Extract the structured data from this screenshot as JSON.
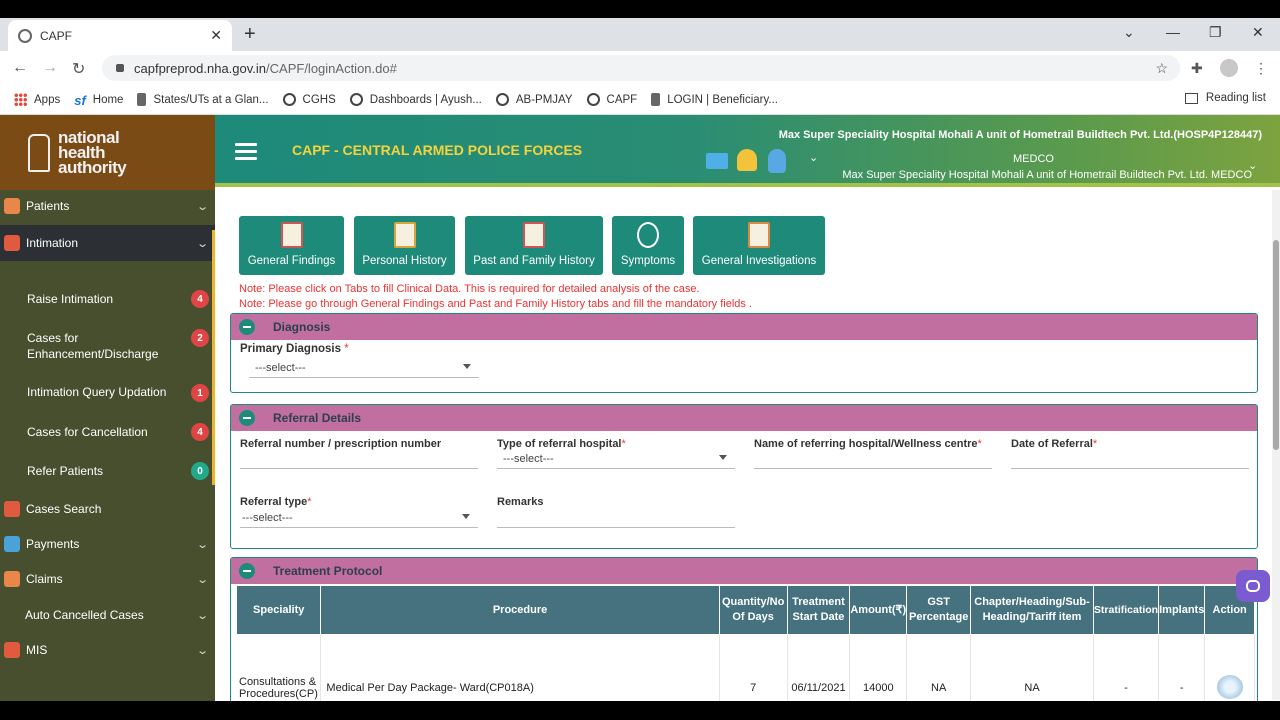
{
  "browser": {
    "tab_title": "CAPF",
    "url_host": "capfpreprod.nha.gov.in",
    "url_path": "/CAPF/loginAction.do#",
    "bookmarks": [
      "Apps",
      "Home",
      "States/UTs at a Glan...",
      "CGHS",
      "Dashboards | Ayush...",
      "AB-PMJAY",
      "CAPF",
      "LOGIN | Beneficiary..."
    ],
    "reading_list": "Reading list"
  },
  "sidebar": {
    "logo_lines": [
      "national",
      "health",
      "authority"
    ],
    "menu": [
      {
        "label": "Patients"
      },
      {
        "label": "Intimation"
      },
      {
        "label": "Cases Search"
      },
      {
        "label": "Payments"
      },
      {
        "label": "Claims"
      },
      {
        "label": "Auto Cancelled Cases"
      },
      {
        "label": "MIS"
      }
    ],
    "submenu": [
      {
        "label": "Raise Intimation",
        "count": "4"
      },
      {
        "label": "Cases for Enhancement/Discharge",
        "count": "2"
      },
      {
        "label": "Intimation Query Updation",
        "count": "1"
      },
      {
        "label": "Cases for Cancellation",
        "count": "4"
      },
      {
        "label": "Refer Patients",
        "count": "0"
      }
    ]
  },
  "header": {
    "title": "CAPF - CENTRAL ARMED POLICE FORCES",
    "hospital_line1": "Max Super Speciality Hospital Mohali A unit of Hometrail Buildtech Pvt. Ltd.(HOSP4P128447)",
    "role": "MEDCO",
    "hospital_line2": "Max Super Speciality Hospital Mohali A unit of Hometrail Buildtech Pvt. Ltd. MEDCO"
  },
  "tabs": [
    "General Findings",
    "Personal History",
    "Past and Family History",
    "Symptoms",
    "General Investigations"
  ],
  "notes": [
    "Note: Please click on Tabs to fill Clinical Data. This is required for detailed analysis of the case.",
    "Note: Please go through General Findings and Past and Family History tabs and fill the mandatory fields ."
  ],
  "diagnosis": {
    "title": "Diagnosis",
    "primary_label": "Primary Diagnosis",
    "primary_value": "---select---"
  },
  "referral": {
    "title": "Referral Details",
    "ref_number_label": "Referral number / prescription number",
    "hospital_type_label": "Type of referral hospital",
    "hospital_type_value": "---select---",
    "referring_hospital_label": "Name of referring hospital/Wellness centre",
    "date_label": "Date of Referral",
    "type_label": "Referral type",
    "type_value": "---select---",
    "remarks_label": "Remarks"
  },
  "treatment": {
    "title": "Treatment Protocol",
    "columns": [
      "Speciality",
      "Procedure",
      "Quantity/No Of Days",
      "Treatment Start Date",
      "Amount(₹)",
      "GST Percentage",
      "Chapter/Heading/Sub-Heading/Tariff item",
      "Stratification",
      "Implants",
      "Action"
    ],
    "rows": [
      {
        "speciality": "Consultations & Procedures(CP)",
        "procedure": "Medical Per Day Package- Ward(CP018A)",
        "quantity": "7",
        "start_date": "06/11/2021",
        "amount": "14000",
        "gst": "NA",
        "chapter": "NA",
        "stratification": "-",
        "implants": "-"
      }
    ]
  },
  "colors": {
    "teal": "#1d8a7a",
    "panel_header": "#c06fa0",
    "sidebar": "#484f2e",
    "title_yellow": "#f5d33d"
  }
}
